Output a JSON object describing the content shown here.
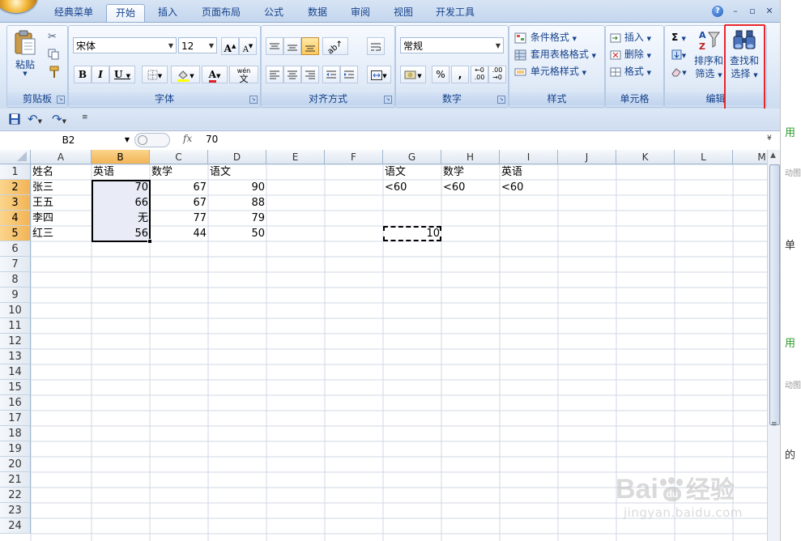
{
  "tabs": [
    "经典菜单",
    "开始",
    "插入",
    "页面布局",
    "公式",
    "数据",
    "审阅",
    "视图",
    "开发工具"
  ],
  "active_tab": "开始",
  "window_controls": {
    "help": "?",
    "minimize": "–",
    "restore": "▫",
    "close": "✕"
  },
  "ribbon": {
    "clipboard": {
      "label": "剪贴板",
      "paste": "粘贴"
    },
    "font": {
      "label": "字体",
      "font_name": "宋体",
      "font_size": "12",
      "bold": "B",
      "italic": "I",
      "underline": "U",
      "phonetic": "wén\n文"
    },
    "alignment": {
      "label": "对齐方式"
    },
    "number": {
      "label": "数字",
      "format": "常规",
      "percent": "%",
      "comma": ","
    },
    "styles": {
      "label": "样式",
      "conditional_format": "条件格式",
      "format_as_table": "套用表格格式",
      "cell_styles": "单元格样式"
    },
    "cells": {
      "label": "单元格",
      "insert": "插入",
      "delete": "删除",
      "format": "格式"
    },
    "editing": {
      "label": "编辑",
      "sort_filter_1": "排序和",
      "sort_filter_2": "筛选",
      "find_select_1": "查找和",
      "find_select_2": "选择"
    }
  },
  "formula_bar": {
    "name_box": "B2",
    "fx": "fx",
    "value": "70"
  },
  "columns": [
    "A",
    "B",
    "C",
    "D",
    "E",
    "F",
    "G",
    "H",
    "I",
    "J",
    "K",
    "L",
    "M"
  ],
  "rows": [
    "1",
    "2",
    "3",
    "4",
    "5",
    "6",
    "7",
    "8",
    "9",
    "10",
    "11",
    "12",
    "13",
    "14",
    "15",
    "16",
    "17",
    "18",
    "19",
    "20",
    "21",
    "22",
    "23",
    "24"
  ],
  "cells": {
    "A1": "姓名",
    "B1": "英语",
    "C1": "数学",
    "D1": "语文",
    "G1": "语文",
    "H1": "数学",
    "I1": "英语",
    "A2": "张三",
    "B2": "70",
    "C2": "67",
    "D2": "90",
    "G2": "<60",
    "H2": "<60",
    "I2": "<60",
    "A3": "王五",
    "B3": "66",
    "C3": "67",
    "D3": "88",
    "A4": "李四",
    "B4": "无",
    "C4": "77",
    "D4": "79",
    "A5": "红三",
    "B5": "56",
    "C5": "44",
    "D5": "50",
    "G5": "10"
  },
  "sidebar_text": [
    "用",
    "动图",
    "单",
    "用",
    "动图",
    "的"
  ],
  "watermark": {
    "brand": "Bai",
    "paw": "du",
    "cn": "经验",
    "url": "jingyan.baidu.com"
  },
  "colors": {
    "highlight_box": "#e8262a",
    "selected_header": "#f2b456",
    "selection_fill": "#e9ecf6"
  }
}
